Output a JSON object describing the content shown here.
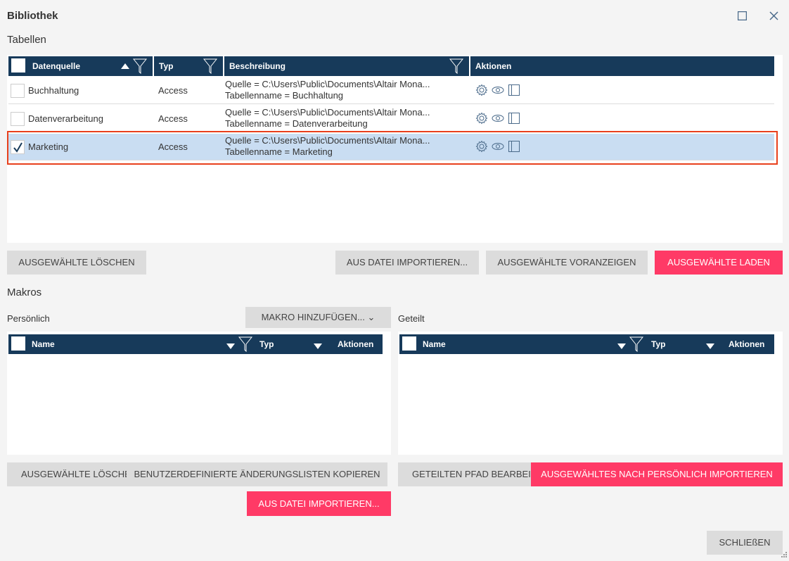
{
  "window": {
    "title": "Bibliothek"
  },
  "tables": {
    "section_title": "Tabellen",
    "columns": [
      "Datenquelle",
      "Typ",
      "Beschreibung",
      "Aktionen"
    ],
    "rows": [
      {
        "name": "Buchhaltung",
        "type": "Access",
        "desc1": "Quelle = C:\\Users\\Public\\Documents\\Altair Mona...",
        "desc2": "Tabellenname = Buchhaltung",
        "checked": false
      },
      {
        "name": "Datenverarbeitung",
        "type": "Access",
        "desc1": "Quelle = C:\\Users\\Public\\Documents\\Altair Mona...",
        "desc2": "Tabellenname = Datenverarbeitung",
        "checked": false
      },
      {
        "name": "Marketing",
        "type": "Access",
        "desc1": "Quelle = C:\\Users\\Public\\Documents\\Altair Mona...",
        "desc2": "Tabellenname = Marketing",
        "checked": true
      }
    ],
    "buttons": {
      "delete": "AUSGEWÄHLTE LÖSCHEN",
      "import": "AUS DATEI IMPORTIEREN...",
      "preview": "AUSGEWÄHLTE VORANZEIGEN",
      "load": "AUSGEWÄHLTE LADEN"
    }
  },
  "macros": {
    "section_title": "Makros",
    "personal_label": "Persönlich",
    "shared_label": "Geteilt",
    "add_button": "MAKRO HINZUFÜGEN...",
    "columns": [
      "Name",
      "Typ",
      "Aktionen"
    ],
    "buttons": {
      "delete": "AUSGEWÄHLTE LÖSCHEN",
      "copy": "BENUTZERDEFINIERTE ÄNDERUNGSLISTEN KOPIEREN",
      "import": "AUS DATEI IMPORTIEREN...",
      "edit_path": "GETEILTEN PFAD BEARBEITEN",
      "import_personal": "AUSGEWÄHLTES NACH PERSÖNLICH IMPORTIEREN"
    }
  },
  "footer": {
    "close": "SCHLIEßEN"
  },
  "colors": {
    "header": "#173a5a",
    "accent": "#ff3a66",
    "selected_row": "#c9ddf2",
    "selection_border": "#e8401c"
  }
}
